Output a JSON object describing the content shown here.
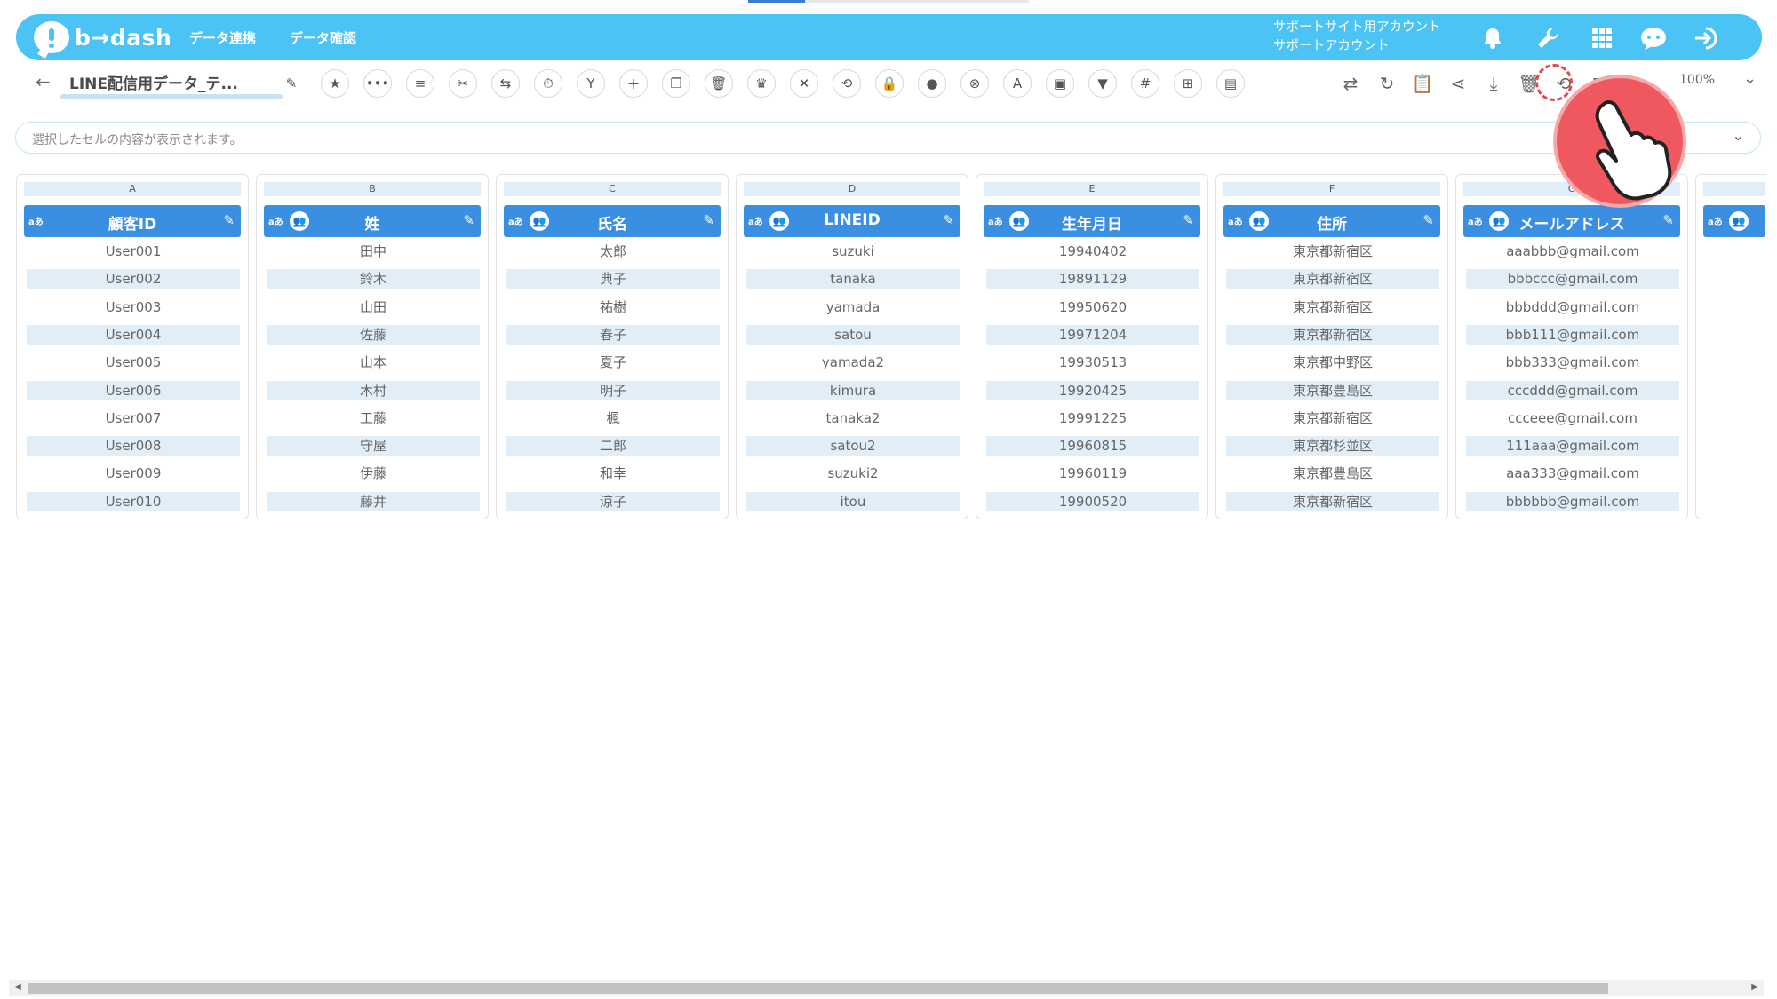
{
  "header": {
    "logo_text": "b→dash",
    "nav": [
      "データ連携",
      "データ確認"
    ],
    "account_line1": "サポートサイト用アカウント",
    "account_line2": "サポートアカウント"
  },
  "toolbar": {
    "back_icon": "back-arrow-icon",
    "title": "LINE配信用データ_テ...",
    "zoom": "100%"
  },
  "cell_bar": {
    "placeholder": "選択したセルの内容が表示されます。"
  },
  "columns": [
    {
      "letter": "A",
      "type": "aあ",
      "name": "顧客ID",
      "has_group": false,
      "cells": [
        "User001",
        "User002",
        "User003",
        "User004",
        "User005",
        "User006",
        "User007",
        "User008",
        "User009",
        "User010"
      ]
    },
    {
      "letter": "B",
      "type": "aあ",
      "name": "姓",
      "has_group": true,
      "cells": [
        "田中",
        "鈴木",
        "山田",
        "佐藤",
        "山本",
        "木村",
        "工藤",
        "守屋",
        "伊藤",
        "藤井"
      ]
    },
    {
      "letter": "C",
      "type": "aあ",
      "name": "氏名",
      "has_group": true,
      "cells": [
        "太郎",
        "典子",
        "祐樹",
        "春子",
        "夏子",
        "明子",
        "楓",
        "二郎",
        "和幸",
        "涼子"
      ]
    },
    {
      "letter": "D",
      "type": "aあ",
      "name": "LINEID",
      "has_group": true,
      "cells": [
        "suzuki",
        "tanaka",
        "yamada",
        "satou",
        "yamada2",
        "kimura",
        "tanaka2",
        "satou2",
        "suzuki2",
        "itou"
      ]
    },
    {
      "letter": "E",
      "type": "aあ",
      "name": "生年月日",
      "has_group": true,
      "cells": [
        "19940402",
        "19891129",
        "19950620",
        "19971204",
        "19930513",
        "19920425",
        "19991225",
        "19960815",
        "19960119",
        "19900520"
      ]
    },
    {
      "letter": "F",
      "type": "aあ",
      "name": "住所",
      "has_group": true,
      "cells": [
        "東京都新宿区",
        "東京都新宿区",
        "東京都新宿区",
        "東京都新宿区",
        "東京都中野区",
        "東京都豊島区",
        "東京都新宿区",
        "東京都杉並区",
        "東京都豊島区",
        "東京都新宿区"
      ]
    },
    {
      "letter": "G",
      "type": "aあ",
      "name": "メールアドレス",
      "has_group": true,
      "cells": [
        "aaabbb@gmail.com",
        "bbbccc@gmail.com",
        "bbbddd@gmail.com",
        "bbb111@gmail.com",
        "bbb333@gmail.com",
        "cccddd@gmail.com",
        "ccceee@gmail.com",
        "111aaa@gmail.com",
        "aaa333@gmail.com",
        "bbbbbb@gmail.com"
      ]
    }
  ],
  "partial_column": {
    "type": "aあ"
  },
  "colors": {
    "header_bg": "#4cc3f5",
    "column_header_bg": "#3a8fe3",
    "alt_row_bg": "#e1eef8",
    "pointer_red": "#f0585f"
  }
}
